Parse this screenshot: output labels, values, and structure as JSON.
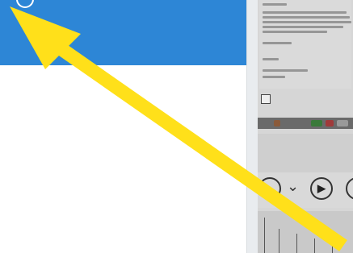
{
  "app": {
    "header_color": "#2d86d6",
    "header_icon": "circle-icon"
  },
  "background_window": {
    "edit_icon": "edit-icon",
    "media_controls": [
      {
        "name": "previous-icon",
        "glyph": "⟲"
      },
      {
        "name": "chevron-down-icon",
        "glyph": "⌄"
      },
      {
        "name": "play-pause-icon",
        "glyph": "▶"
      },
      {
        "name": "more-icon",
        "glyph": ""
      }
    ]
  },
  "annotation": {
    "type": "arrow",
    "color": "#ffe01a",
    "points_to": "header-icon"
  }
}
